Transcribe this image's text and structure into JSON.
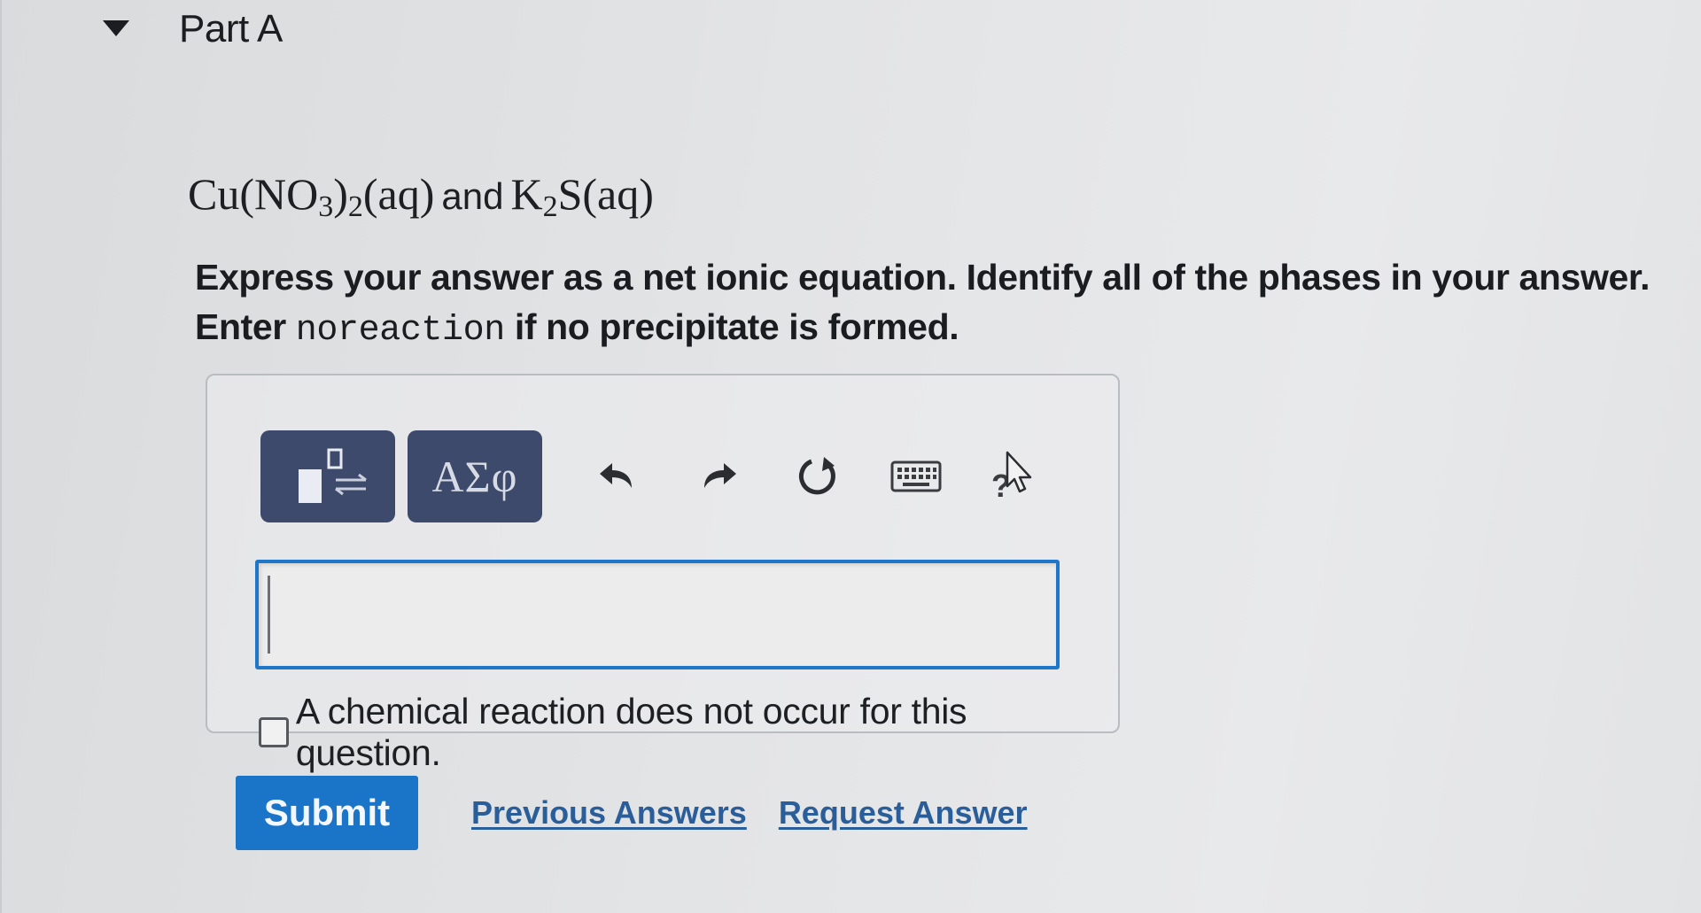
{
  "part": {
    "title": "Part A"
  },
  "question": {
    "reaction": {
      "reactant1_formula_a": "Cu(NO",
      "reactant1_sub_a": "3",
      "reactant1_formula_b": ")",
      "reactant1_sub_b": "2",
      "reactant1_state": "(aq)",
      "connector": "and",
      "reactant2_formula_a": "K",
      "reactant2_sub_a": "2",
      "reactant2_formula_b": "S",
      "reactant2_state": "(aq)"
    },
    "instruction_line1": "Express your answer as a net ionic equation. Identify all of the phases in your answer.",
    "instruction_line2_prefix": "Enter ",
    "instruction_line2_code": "noreaction",
    "instruction_line2_suffix": " if no precipitate is formed."
  },
  "toolbar": {
    "templates_icon": "superscript-equilibrium-template-icon",
    "greek_label": "ΑΣφ",
    "undo_icon": "undo-icon",
    "redo_icon": "redo-icon",
    "reset_icon": "reset-icon",
    "keyboard_icon": "keyboard-icon",
    "help_icon": "help-icon"
  },
  "answer": {
    "value": ""
  },
  "no_reaction": {
    "checked": false,
    "label": "A chemical reaction does not occur for this question."
  },
  "actions": {
    "submit_label": "Submit",
    "previous_answers_label": "Previous Answers",
    "request_answer_label": "Request Answer"
  },
  "colors": {
    "primary": "#1a74c8",
    "toolbar_button": "#3d4a6b",
    "link": "#2a5e9a",
    "input_border": "#1f77c9"
  }
}
